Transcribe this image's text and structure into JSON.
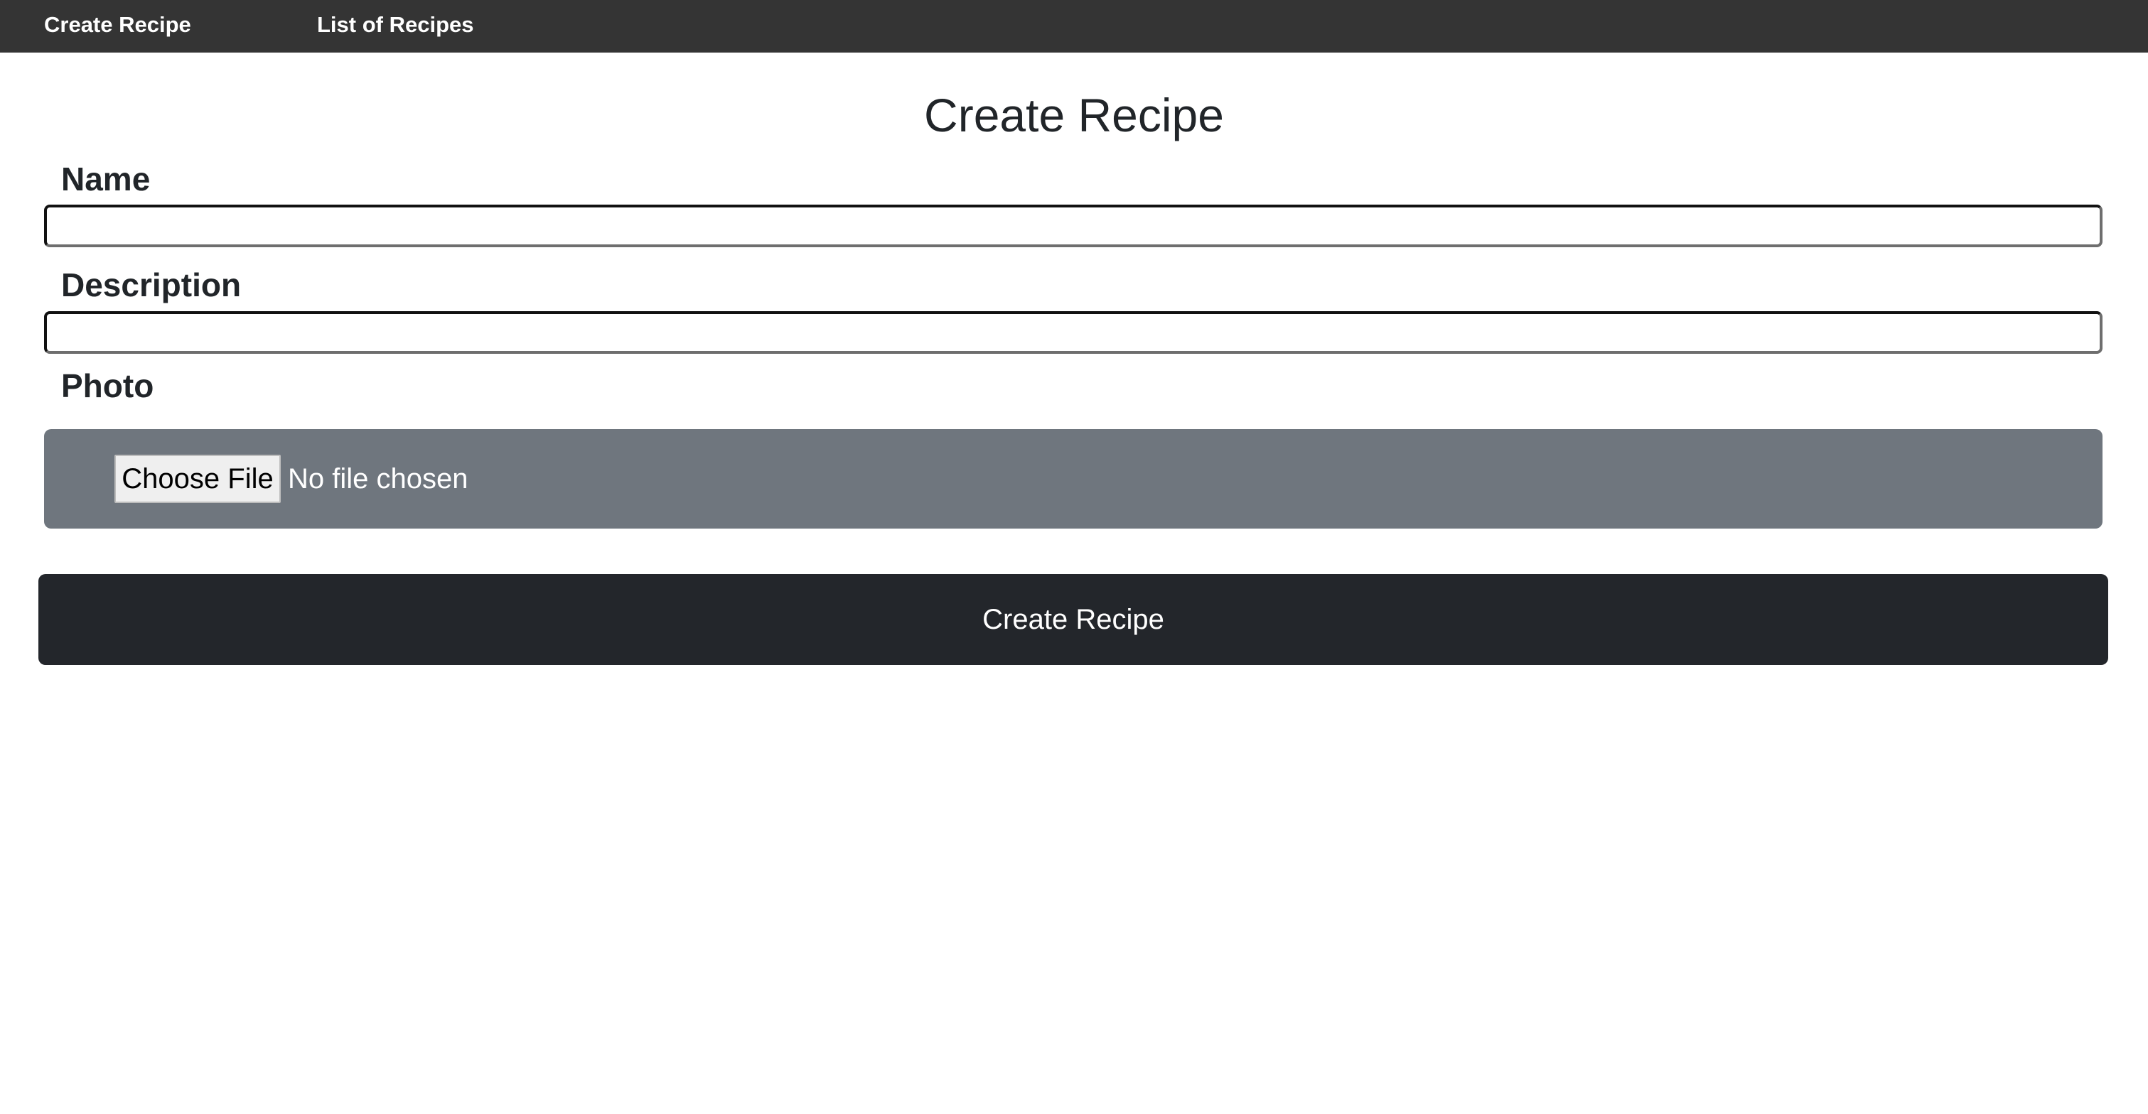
{
  "nav": {
    "items": [
      {
        "label": "Create Recipe"
      },
      {
        "label": "List of Recipes"
      }
    ]
  },
  "page": {
    "title": "Create Recipe"
  },
  "form": {
    "name": {
      "label": "Name",
      "value": ""
    },
    "description": {
      "label": "Description",
      "value": ""
    },
    "photo": {
      "label": "Photo",
      "button_label": "Choose File",
      "status": "No file chosen"
    },
    "submit_label": "Create Recipe"
  },
  "colors": {
    "navbar": "#343434",
    "file_box": "#6f767e",
    "submit_button": "#23262b"
  }
}
